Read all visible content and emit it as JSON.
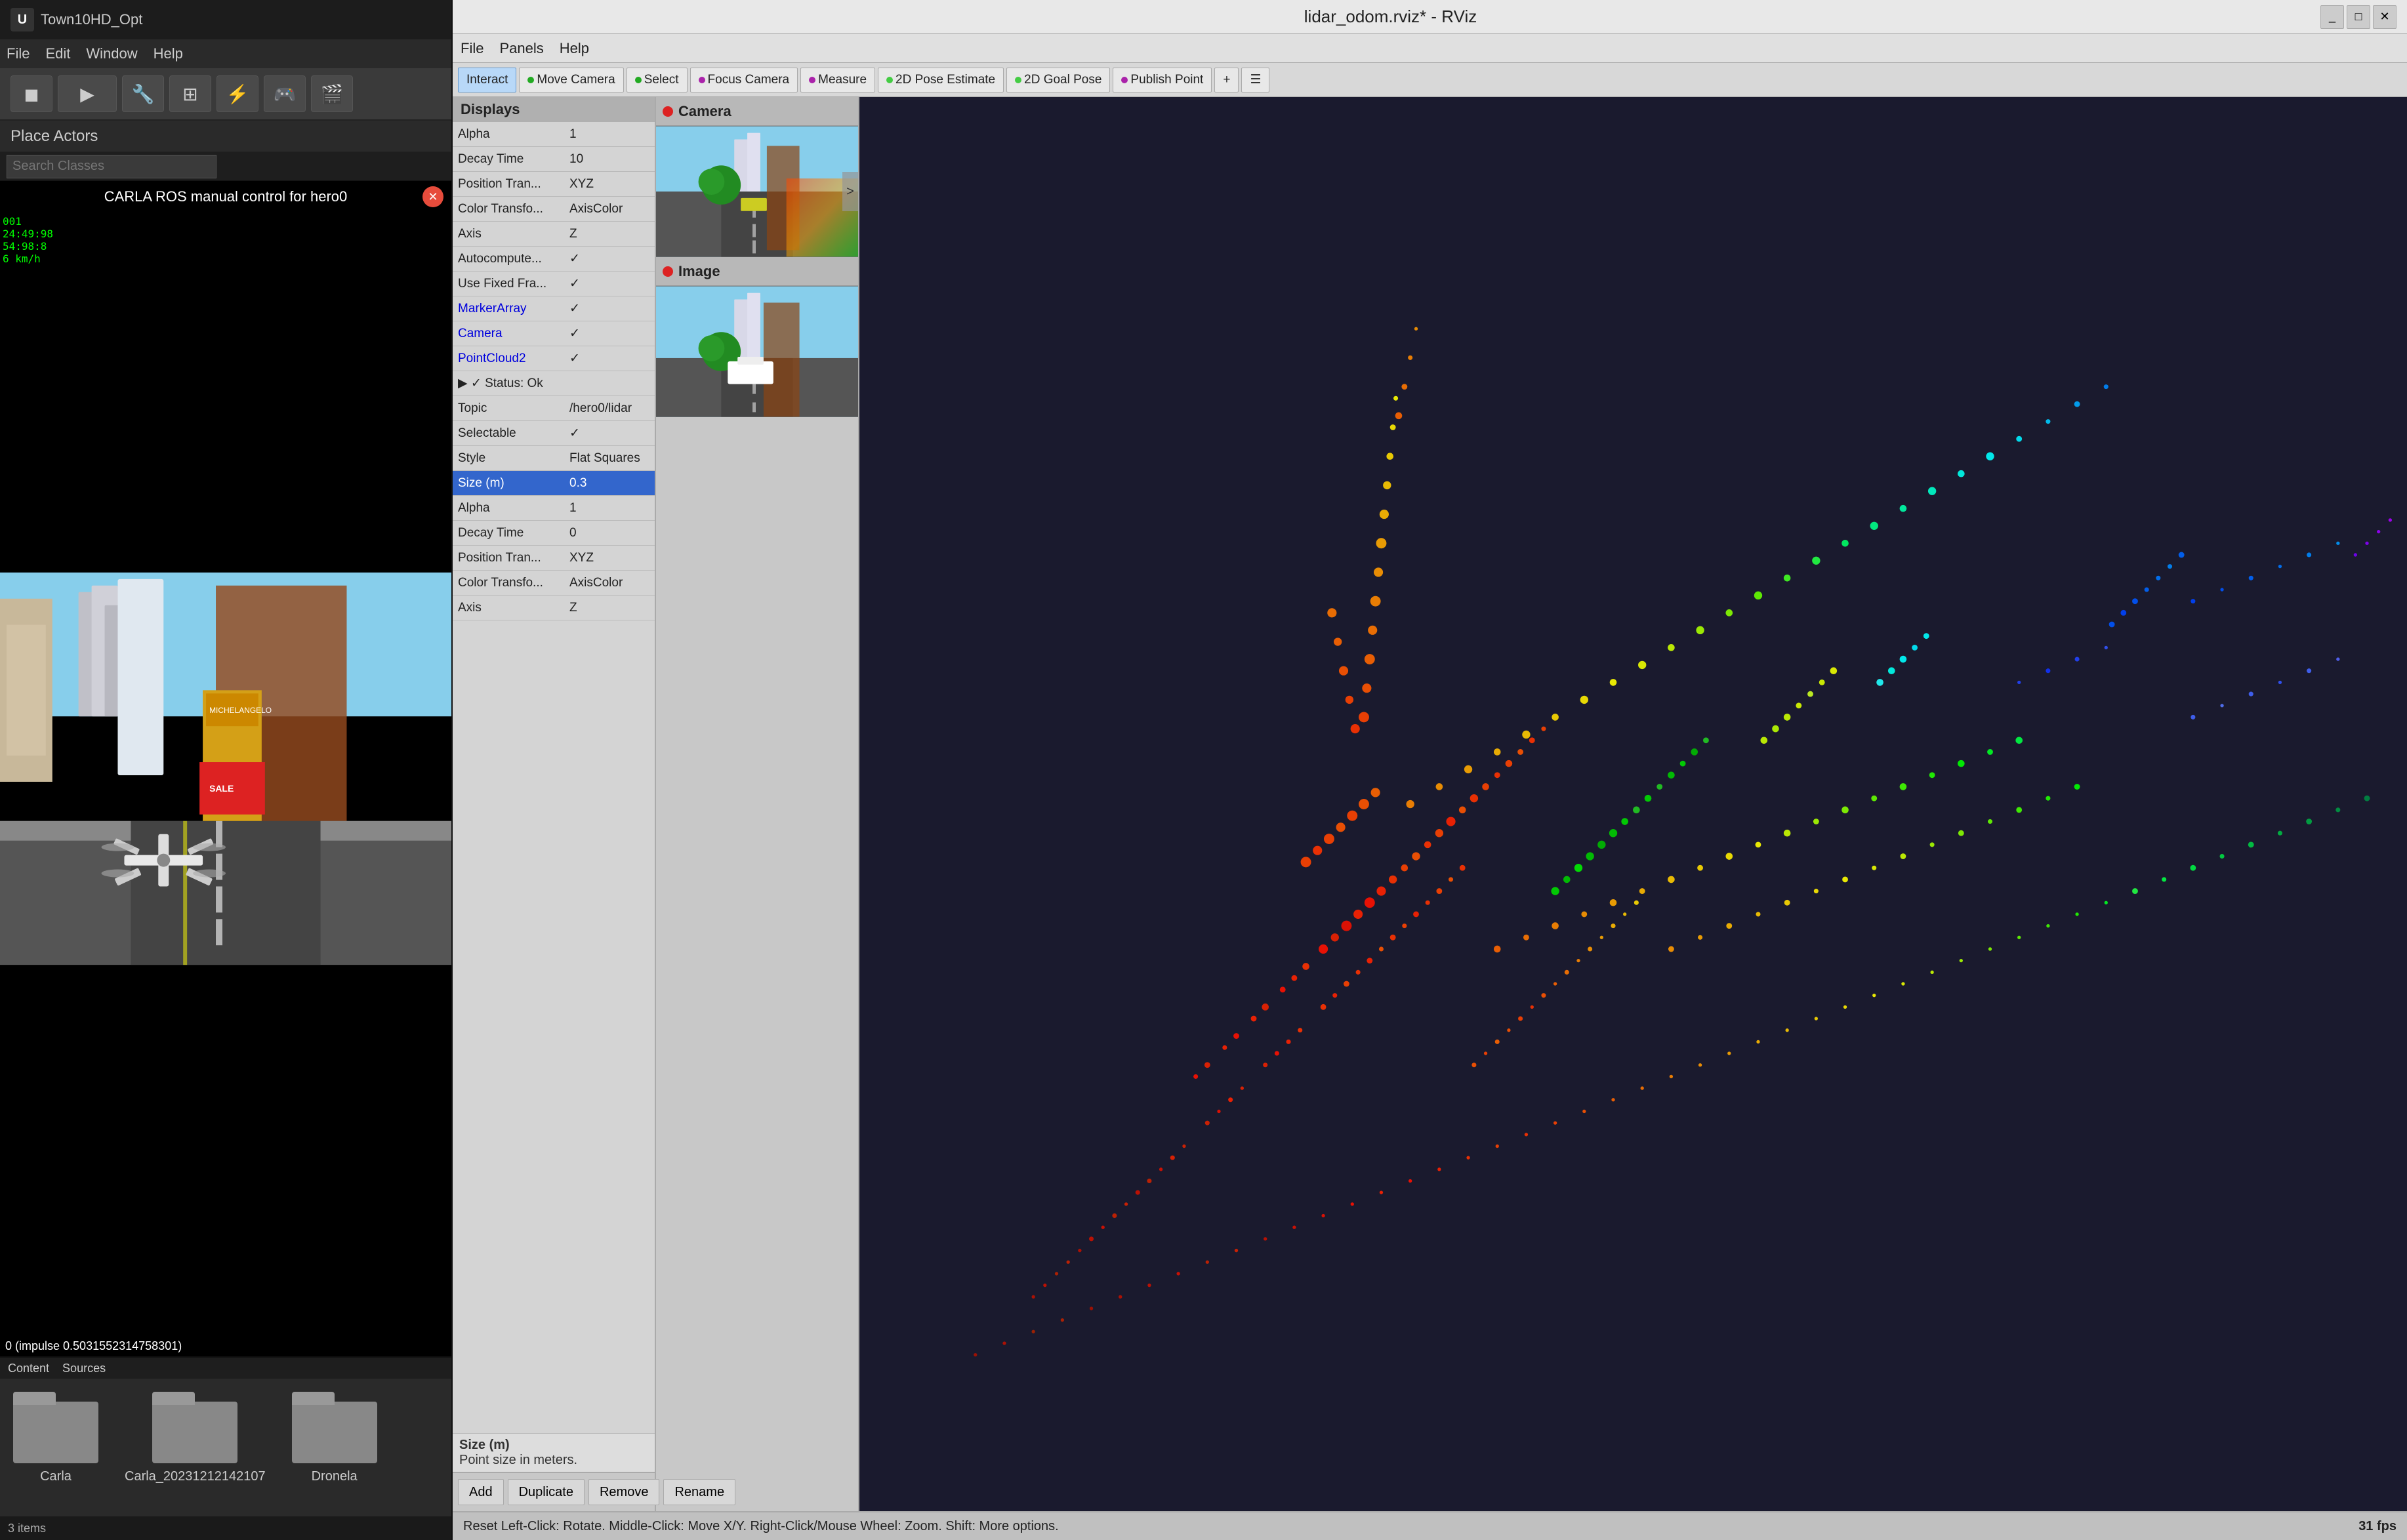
{
  "ue": {
    "title": "Town10HD_Opt",
    "logo": "U",
    "menu": [
      "File",
      "Edit",
      "Window",
      "Help"
    ],
    "toolbar_tools": [
      "◼",
      "▶",
      "🔧",
      "⊞",
      "⚡",
      "🎮",
      "🎬"
    ],
    "place_actors_label": "Place Actors",
    "search_placeholder": "Search Classes",
    "carla_title": "CARLA ROS manual control for hero0",
    "hud_lines": [
      "001",
      "24:49:98",
      "54:98:8",
      "6 km/h",
      "24:49:98",
      "54:98:8"
    ],
    "impulse_text": "0 (impulse 0.5031552314758301)",
    "content_tabs": [
      "Content",
      "Sources"
    ],
    "folders": [
      {
        "name": "Carla"
      },
      {
        "name": "Carla_20231212142107"
      },
      {
        "name": "Dronela"
      }
    ],
    "items_count": "3 items"
  },
  "rviz": {
    "title": "lidar_odom.rviz* - RViz",
    "win_btns": [
      "_",
      "□",
      "✕"
    ],
    "menu": [
      "File",
      "Panels",
      "Help"
    ],
    "tools": [
      {
        "label": "Interact",
        "active": true,
        "bullet_color": ""
      },
      {
        "label": "Move Camera",
        "active": false,
        "bullet_color": "#22aa22"
      },
      {
        "label": "Select",
        "active": false,
        "bullet_color": "#22aa22"
      },
      {
        "label": "Focus Camera",
        "active": false,
        "bullet_color": "#aa22aa"
      },
      {
        "label": "Measure",
        "active": false,
        "bullet_color": "#aa22aa"
      },
      {
        "label": "2D Pose Estimate",
        "active": false,
        "bullet_color": "#44cc44"
      },
      {
        "label": "2D Goal Pose",
        "active": false,
        "bullet_color": "#44cc44"
      },
      {
        "label": "Publish Point",
        "active": false,
        "bullet_color": "#aa22aa"
      }
    ],
    "displays_header": "Displays",
    "display_rows": [
      {
        "key": "Alpha",
        "val": "1",
        "selected": false,
        "blue": false
      },
      {
        "key": "Decay Time",
        "val": "10",
        "selected": false,
        "blue": false
      },
      {
        "key": "Position Tran...",
        "val": "XYZ",
        "selected": false,
        "blue": false
      },
      {
        "key": "Color Transfo...",
        "val": "AxisColor",
        "selected": false,
        "blue": false
      },
      {
        "key": "Axis",
        "val": "Z",
        "selected": false,
        "blue": false
      },
      {
        "key": "Autocompute...",
        "val": "✓",
        "selected": false,
        "blue": false
      },
      {
        "key": "Use Fixed Fra...",
        "val": "✓",
        "selected": false,
        "blue": false
      },
      {
        "key": "MarkerArray",
        "val": "✓",
        "selected": false,
        "blue": true
      },
      {
        "key": "Camera",
        "val": "✓",
        "selected": false,
        "blue": true
      },
      {
        "key": "PointCloud2",
        "val": "✓",
        "selected": false,
        "blue": true
      },
      {
        "key": "▶ ✓ Status: Ok",
        "val": "",
        "selected": false,
        "blue": false
      },
      {
        "key": "Topic",
        "val": "/hero0/lidar",
        "selected": false,
        "blue": false
      },
      {
        "key": "Selectable",
        "val": "✓",
        "selected": false,
        "blue": false
      },
      {
        "key": "Style",
        "val": "Flat Squares",
        "selected": false,
        "blue": false
      },
      {
        "key": "Size (m)",
        "val": "0.3",
        "selected": true,
        "blue": false
      },
      {
        "key": "Alpha",
        "val": "1",
        "selected": false,
        "blue": false
      },
      {
        "key": "Decay Time",
        "val": "0",
        "selected": false,
        "blue": false
      },
      {
        "key": "Position Tran...",
        "val": "XYZ",
        "selected": false,
        "blue": false
      },
      {
        "key": "Color Transfo...",
        "val": "AxisColor",
        "selected": false,
        "blue": false
      },
      {
        "key": "Axis",
        "val": "Z",
        "selected": false,
        "blue": false
      }
    ],
    "size_info_title": "Size (m)",
    "size_info_desc": "Point size in meters.",
    "display_btns": [
      "Add",
      "Duplicate",
      "Remove",
      "Rename"
    ],
    "camera_label": "Camera",
    "image_label": "Image",
    "statusbar_text": "Reset  Left-Click: Rotate.  Middle-Click: Move X/Y.  Right-Click/Mouse Wheel: Zoom.  Shift: More options.",
    "fps": "31 fps"
  }
}
